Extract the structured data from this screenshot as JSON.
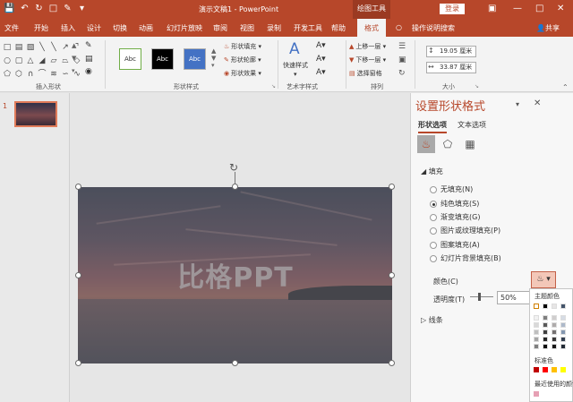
{
  "app": {
    "window_title": "演示文稿1 - PowerPoint",
    "context_tab_group": "绘图工具",
    "login_label": "登录",
    "share_label": "共享",
    "brand_color": "#b7472a"
  },
  "quick_access": {
    "save_icon": "save-icon",
    "undo_icon": "undo-icon",
    "redo_icon": "redo-icon"
  },
  "tabs": [
    {
      "label": "文件"
    },
    {
      "label": "开始"
    },
    {
      "label": "插入"
    },
    {
      "label": "设计"
    },
    {
      "label": "切换"
    },
    {
      "label": "动画"
    },
    {
      "label": "幻灯片放映"
    },
    {
      "label": "审阅"
    },
    {
      "label": "视图"
    },
    {
      "label": "录制"
    },
    {
      "label": "开发工具"
    },
    {
      "label": "帮助"
    },
    {
      "label": "格式",
      "active": true
    }
  ],
  "tell_me": "操作说明搜索",
  "ribbon": {
    "insert_shapes_label": "插入形状",
    "shape_styles_label": "形状样式",
    "style_sample": "Abc",
    "shape_fill": "形状填充",
    "shape_outline": "形状轮廓",
    "shape_effects": "形状效果",
    "quick_styles": "快速样式",
    "wordart_label": "艺术字样式",
    "bring_forward": "上移一层",
    "send_backward": "下移一层",
    "selection_pane": "选择窗格",
    "arrange_label": "排列",
    "height": "19.05 厘米",
    "width": "33.87 厘米",
    "size_label": "大小"
  },
  "slides": {
    "number": "1"
  },
  "slide": {
    "text": "比格PPT"
  },
  "pane": {
    "title": "设置形状格式",
    "tab_shape": "形状选项",
    "tab_text": "文本选项",
    "fill_section": "填充",
    "fill_options": [
      {
        "label": "无填充(N)",
        "selected": false
      },
      {
        "label": "纯色填充(S)",
        "selected": true
      },
      {
        "label": "渐变填充(G)",
        "selected": false
      },
      {
        "label": "图片或纹理填充(P)",
        "selected": false
      },
      {
        "label": "图案填充(A)",
        "selected": false
      },
      {
        "label": "幻灯片背景填充(B)",
        "selected": false
      }
    ],
    "color_label": "颜色(C)",
    "transparency_label": "透明度(T)",
    "transparency_value": "50%",
    "line_section": "线条"
  },
  "color_popup": {
    "theme_colors": "主题颜色",
    "standard_colors": "标准色",
    "recent_colors": "最近使用的颜色",
    "standard": [
      "#c00000",
      "#ff0000",
      "#ffc000",
      "#ffff00"
    ],
    "recent": [
      "#e6a0b4"
    ]
  }
}
